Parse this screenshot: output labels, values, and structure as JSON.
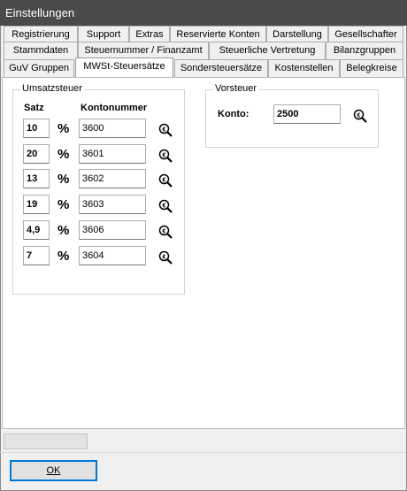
{
  "window": {
    "title": "Einstellungen"
  },
  "tabs": {
    "row1": [
      "Registrierung",
      "Support",
      "Extras",
      "Reservierte Konten",
      "Darstellung",
      "Gesellschafter"
    ],
    "row2": [
      "Stammdaten",
      "Steuernummer / Finanzamt",
      "Steuerliche Vertretung",
      "Bilanzgruppen"
    ],
    "row3": [
      "GuV Gruppen",
      "MWSt-Steuersätze",
      "Sondersteuersätze",
      "Kostenstellen",
      "Belegkreise"
    ],
    "active": "MWSt-Steuersätze"
  },
  "umsatzsteuer": {
    "title": "Umsatzsteuer",
    "satz_header": "Satz",
    "konto_header": "Kontonummer",
    "percent_sign": "%",
    "rows": [
      {
        "satz": "10",
        "konto": "3600"
      },
      {
        "satz": "20",
        "konto": "3601"
      },
      {
        "satz": "13",
        "konto": "3602"
      },
      {
        "satz": "19",
        "konto": "3603"
      },
      {
        "satz": "4,9",
        "konto": "3606"
      },
      {
        "satz": "7",
        "konto": "3604"
      }
    ]
  },
  "vorsteuer": {
    "title": "Vorsteuer",
    "konto_label": "Konto:",
    "konto_value": "2500"
  },
  "buttons": {
    "ok": "OK"
  },
  "icons": {
    "lookup": "account-lookup-icon"
  }
}
